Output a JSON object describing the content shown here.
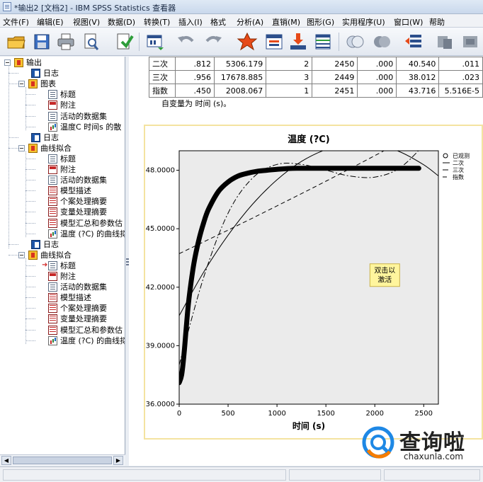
{
  "window": {
    "title": "*输出2 [文档2] - IBM SPSS Statistics 查看器"
  },
  "menu": [
    "文件(F)",
    "编辑(E)",
    "视图(V)",
    "数据(D)",
    "转换(T)",
    "插入(I)",
    "格式",
    "分析(A)",
    "直销(M)",
    "图形(G)",
    "实用程序(U)",
    "窗口(W)",
    "帮助"
  ],
  "toolbar": {
    "icons": [
      "open-icon",
      "save-icon",
      "print-icon",
      "print-preview-icon",
      "export-icon",
      "recall-dialog-icon",
      "undo-icon",
      "redo-icon",
      "goto-data-icon",
      "goto-case-icon",
      "goto-variable-icon",
      "variables-icon",
      "show-all-icon",
      "hide-icon",
      "promote-icon",
      "demote-icon",
      "designate-window-icon"
    ]
  },
  "outline": {
    "items": [
      {
        "label": "输出",
        "icon": "output-book-icon",
        "level": 0
      },
      {
        "label": "日志",
        "icon": "log-icon",
        "level": 1
      },
      {
        "label": "图表",
        "icon": "output-book-icon",
        "level": 1
      },
      {
        "label": "标题",
        "icon": "title-doc-icon",
        "level": 2
      },
      {
        "label": "附注",
        "icon": "notes-icon",
        "level": 2
      },
      {
        "label": "活动的数据集",
        "icon": "doc-icon",
        "level": 2
      },
      {
        "label": "温度C 时间s 的散",
        "icon": "chart-icon",
        "level": 2
      },
      {
        "label": "日志",
        "icon": "log-icon",
        "level": 1
      },
      {
        "label": "曲线拟合",
        "icon": "output-book-icon",
        "level": 1
      },
      {
        "label": "标题",
        "icon": "title-doc-icon",
        "level": 2
      },
      {
        "label": "附注",
        "icon": "notes-icon",
        "level": 2
      },
      {
        "label": "活动的数据集",
        "icon": "doc-icon",
        "level": 2
      },
      {
        "label": "模型描述",
        "icon": "table-icon",
        "level": 2
      },
      {
        "label": "个案处理摘要",
        "icon": "table-icon",
        "level": 2
      },
      {
        "label": "变量处理摘要",
        "icon": "table-icon",
        "level": 2
      },
      {
        "label": "模型汇总和参数估",
        "icon": "table-icon",
        "level": 2
      },
      {
        "label": "温度 (?C) 的曲线拟",
        "icon": "chart-icon",
        "level": 2
      },
      {
        "label": "日志",
        "icon": "log-icon",
        "level": 1
      },
      {
        "label": "曲线拟合",
        "icon": "output-book-icon",
        "level": 1
      },
      {
        "label": "标题",
        "icon": "title-doc-icon",
        "level": 2
      },
      {
        "label": "附注",
        "icon": "notes-icon",
        "level": 2
      },
      {
        "label": "活动的数据集",
        "icon": "doc-icon",
        "level": 2
      },
      {
        "label": "模型描述",
        "icon": "table-icon",
        "level": 2
      },
      {
        "label": "个案处理摘要",
        "icon": "table-icon",
        "level": 2
      },
      {
        "label": "变量处理摘要",
        "icon": "table-icon",
        "level": 2
      },
      {
        "label": "模型汇总和参数估",
        "icon": "table-icon",
        "level": 2
      },
      {
        "label": "温度 (?C) 的曲线拟",
        "icon": "chart-icon",
        "level": 2
      }
    ],
    "current_item_marker": "➜"
  },
  "results_table": {
    "rows": [
      [
        "二次",
        ".812",
        "5306.179",
        "2",
        "2450",
        ".000",
        "40.540",
        ".011"
      ],
      [
        "三次",
        ".956",
        "17678.885",
        "3",
        "2449",
        ".000",
        "38.012",
        ".023"
      ],
      [
        "指数",
        ".450",
        "2008.067",
        "1",
        "2451",
        ".000",
        "43.716",
        "5.516E-5"
      ]
    ],
    "footnote": "自变量为 时间 (s)。"
  },
  "chart_data": {
    "type": "line",
    "title": "温度 (?C)",
    "xlabel": "时间 (s)",
    "ylabel": "",
    "xlim": [
      0,
      2650
    ],
    "ylim": [
      36.0,
      49.0
    ],
    "x_ticks": [
      "0",
      "500",
      "1000",
      "1500",
      "2000",
      "2500"
    ],
    "y_ticks": [
      "36.0000",
      "39.0000",
      "42.0000",
      "45.0000",
      "48.0000"
    ],
    "grid": false,
    "legend_position": "right",
    "series": [
      {
        "name": "已观测",
        "style": "observed",
        "x": [
          0,
          25,
          50,
          75,
          100,
          150,
          200,
          250,
          300,
          400,
          500,
          600,
          700,
          800,
          900,
          1000,
          1200,
          1500,
          1800,
          2100,
          2450
        ],
        "y": [
          37.1,
          37.5,
          38.6,
          40.1,
          41.4,
          43.2,
          44.4,
          45.3,
          46.0,
          46.9,
          47.4,
          47.7,
          47.85,
          47.95,
          48.0,
          48.05,
          48.1,
          48.1,
          48.1,
          48.1,
          48.1
        ]
      },
      {
        "name": "二次",
        "style": "solid",
        "x": [
          0,
          250,
          500,
          750,
          1000,
          1250,
          1500,
          1750,
          2000,
          2250,
          2500,
          2650
        ],
        "y": [
          40.54,
          42.77,
          44.67,
          46.26,
          47.51,
          48.45,
          49.06,
          49.35,
          49.31,
          48.96,
          48.28,
          47.71
        ]
      },
      {
        "name": "三次",
        "style": "dash-dot",
        "x": [
          0,
          250,
          500,
          750,
          1000,
          1250,
          1500,
          1750,
          2000,
          2250,
          2500,
          2650
        ],
        "y": [
          38.01,
          42.5,
          45.8,
          47.6,
          48.3,
          48.3,
          48.0,
          47.7,
          47.65,
          48.1,
          49.3,
          50.3
        ]
      },
      {
        "name": "指数",
        "style": "dashed",
        "x": [
          0,
          500,
          1000,
          1500,
          2000,
          2500,
          2650
        ],
        "y": [
          43.72,
          44.93,
          46.17,
          47.44,
          48.75,
          50.1,
          50.5
        ]
      }
    ],
    "annotation": "双击以\n激活"
  },
  "watermark": {
    "text_cn": "查询啦",
    "text_en": "chaxunla.com"
  },
  "colors": {
    "chart_bg": "#ebebeb",
    "frame": "#f4e3a0",
    "annotation_bg": "#fff59d",
    "watermark_blue": "#1e88e5",
    "watermark_orange": "#f57c00"
  }
}
